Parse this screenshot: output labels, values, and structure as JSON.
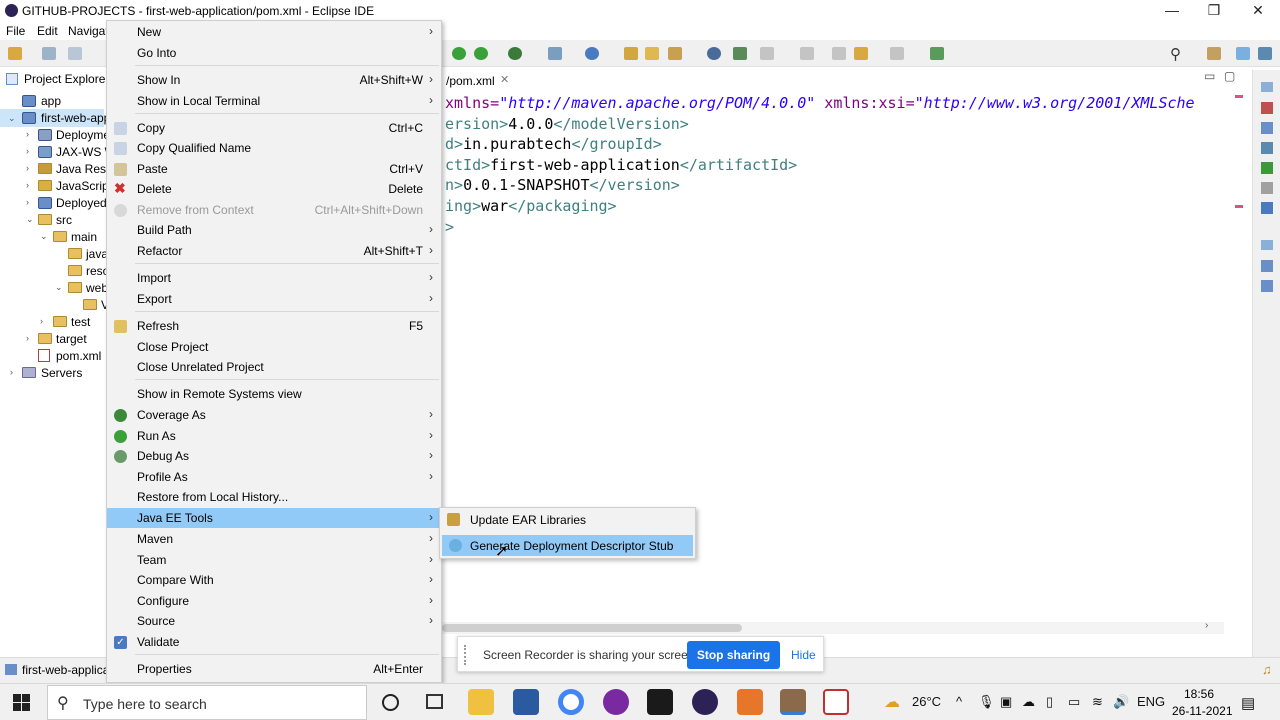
{
  "window": {
    "title": "GITHUB-PROJECTS - first-web-application/pom.xml - Eclipse IDE",
    "minimize": "—",
    "restore": "❐",
    "close": "✕"
  },
  "menubar": {
    "file": "File",
    "edit": "Edit",
    "navigate": "Navigat"
  },
  "explorer": {
    "title": "Project Explorer",
    "items": {
      "app": "app",
      "project": "first-web-app",
      "deployment": "Deployme",
      "jaxws": "JAX-WS W",
      "javares": "Java Reso",
      "javascript": "JavaScript",
      "deployed": "Deployed",
      "src": "src",
      "main": "main",
      "java": "java",
      "res": "reso",
      "web": "web",
      "webchild": "V",
      "test": "test",
      "target": "target",
      "pom": "pom.xml",
      "servers": "Servers"
    }
  },
  "editor": {
    "tab": "/pom.xml",
    "lines": {
      "l1a": "xmlns=",
      "l1b": "\"http://maven.apache.org/POM/4.0.0\"",
      "l1c": " xmlns:xsi=",
      "l1d": "\"http://www.w3.org/2001/XMLSche",
      "l2a": "ersion>",
      "l2b": "4.0.0",
      "l2c": "</modelVersion>",
      "l3a": "d>",
      "l3b": "in.purabtech",
      "l3c": "</groupId>",
      "l4a": "ctId>",
      "l4b": "first-web-application",
      "l4c": "</artifactId>",
      "l5a": "n>",
      "l5b": "0.0.1-SNAPSHOT",
      "l5c": "</version>",
      "l6a": "ing>",
      "l6b": "war",
      "l6c": "</packaging>",
      "l7a": ">"
    }
  },
  "context_menu": {
    "new": "New",
    "go_into": "Go Into",
    "show_in": "Show In",
    "show_in_sc": "Alt+Shift+W",
    "show_local_terminal": "Show in Local Terminal",
    "copy": "Copy",
    "copy_sc": "Ctrl+C",
    "copy_qualified": "Copy Qualified Name",
    "paste": "Paste",
    "paste_sc": "Ctrl+V",
    "delete": "Delete",
    "delete_sc": "Delete",
    "remove_context": "Remove from Context",
    "remove_context_sc": "Ctrl+Alt+Shift+Down",
    "build_path": "Build Path",
    "refactor": "Refactor",
    "refactor_sc": "Alt+Shift+T",
    "import": "Import",
    "export": "Export",
    "refresh": "Refresh",
    "refresh_sc": "F5",
    "close_project": "Close Project",
    "close_unrelated": "Close Unrelated Project",
    "show_remote": "Show in Remote Systems view",
    "coverage_as": "Coverage As",
    "run_as": "Run As",
    "debug_as": "Debug As",
    "profile_as": "Profile As",
    "restore_history": "Restore from Local History...",
    "javaee_tools": "Java EE Tools",
    "maven": "Maven",
    "team": "Team",
    "compare_with": "Compare With",
    "configure": "Configure",
    "source": "Source",
    "validate": "Validate",
    "properties": "Properties",
    "properties_sc": "Alt+Enter",
    "arrow": "›"
  },
  "submenu": {
    "update_ear": "Update EAR Libraries",
    "generate_dd": "Generate Deployment Descriptor Stub"
  },
  "recorder": {
    "message": "Screen Recorder is sharing your screen.",
    "stop": "Stop sharing",
    "hide": "Hide"
  },
  "status": {
    "selection": "first-web-applica"
  },
  "taskbar": {
    "search_placeholder": "Type here to search",
    "weather": "26°C",
    "lang": "ENG",
    "time": "18:56",
    "date": "26-11-2021"
  }
}
